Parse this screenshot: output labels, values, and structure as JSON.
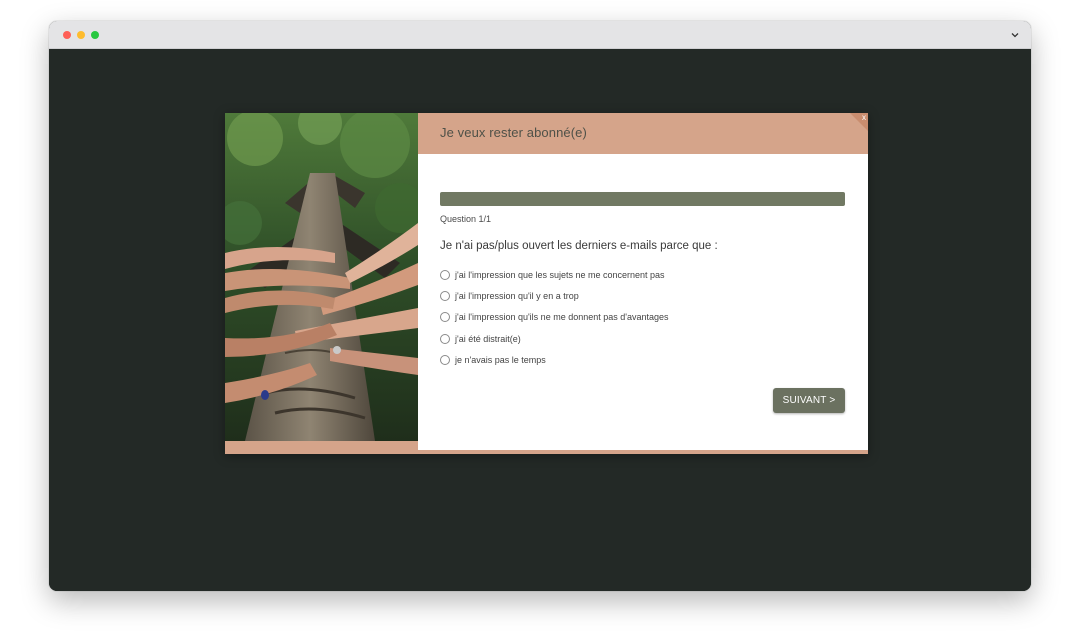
{
  "modal": {
    "header_title": "Je veux rester abonné(e)",
    "close_label": "x",
    "progress": {
      "value": 1.0,
      "label": "Question 1/1"
    },
    "question": "Je n'ai pas/plus ouvert les derniers e-mails parce que :",
    "options": [
      "j'ai l'impression que les sujets ne me concernent pas",
      "j'ai l'impression qu'il y en a trop",
      "j'ai l'impression qu'ils ne me donnent pas d'avantages",
      "j'ai été distrait(e)",
      "je n'avais pas le temps"
    ],
    "next_label": "SUIVANT >"
  },
  "colors": {
    "page_background": "#232926",
    "accent": "#d5a48a",
    "progress_fill": "#717963",
    "button": "#6b7160"
  },
  "icons": {
    "window_controls": [
      "close-dot",
      "minimize-dot",
      "maximize-dot"
    ],
    "menu": "chevron-down-icon",
    "close": "close-icon"
  }
}
